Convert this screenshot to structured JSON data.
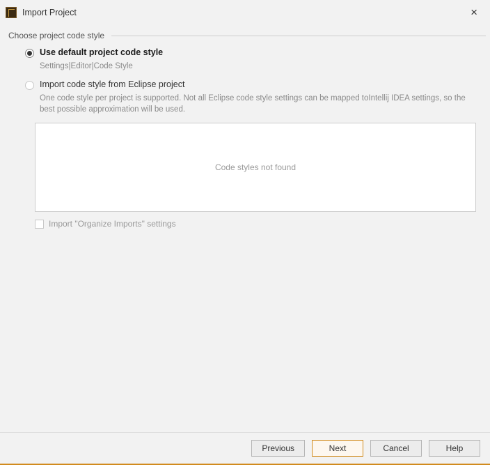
{
  "window": {
    "title": "Import Project"
  },
  "section": {
    "heading": "Choose project code style"
  },
  "radio1": {
    "label": "Use default project code style",
    "desc": "Settings|Editor|Code Style"
  },
  "radio2": {
    "label": "Import code style from Eclipse project",
    "desc": "One code style per project is supported. Not all Eclipse code style settings can be mapped toIntellij IDEA settings, so the best possible approximation will be used."
  },
  "styles_box": {
    "empty_text": "Code styles not found"
  },
  "organize": {
    "label": "Import \"Organize Imports\" settings"
  },
  "footer": {
    "previous": "Previous",
    "next": "Next",
    "cancel": "Cancel",
    "help": "Help"
  }
}
